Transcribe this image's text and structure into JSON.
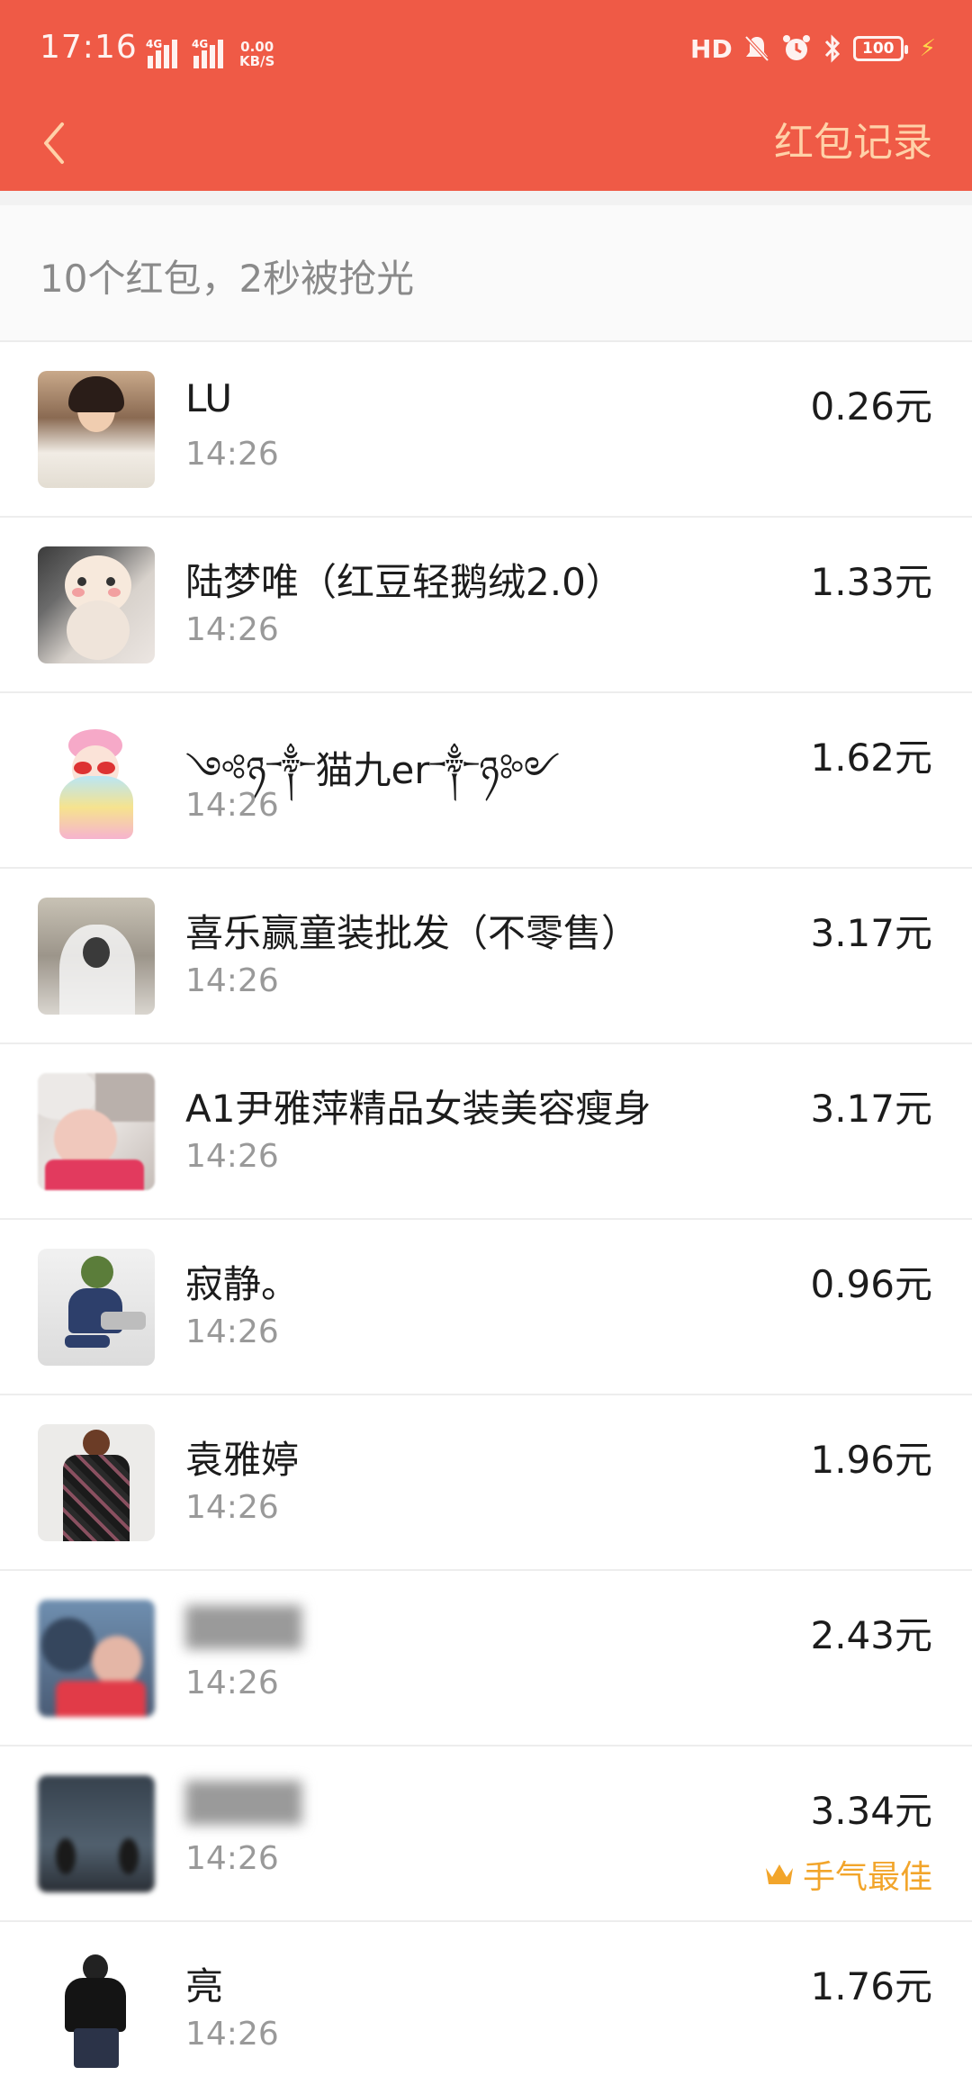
{
  "status_bar": {
    "time": "17:16",
    "signal_1_tag": "4G",
    "signal_2_tag": "4G",
    "net_speed_value": "0.00",
    "net_speed_unit": "KB/S",
    "hd_label": "HD",
    "battery_level": "100"
  },
  "nav": {
    "title": "红包记录"
  },
  "summary": {
    "text": "10个红包，2秒被抢光"
  },
  "records": [
    {
      "name": "LU",
      "time": "14:26",
      "amount": "0.26元",
      "avatar": "photo-girl-white-jacket"
    },
    {
      "name": "陆梦唯（红豆轻鹅绒2.0）",
      "time": "14:26",
      "amount": "1.33元",
      "avatar": "cat-photo"
    },
    {
      "name": "༺ཉ༒猫九er༒ཉ༻",
      "time": "14:26",
      "amount": "1.62元",
      "avatar": "cartoon-girl"
    },
    {
      "name": "喜乐赢童装批发（不零售）",
      "time": "14:26",
      "amount": "3.17元",
      "avatar": "veil-photo"
    },
    {
      "name": "A1尹雅萍精品女装美容瘦身",
      "time": "14:26",
      "amount": "3.17元",
      "avatar": "blurred-child"
    },
    {
      "name": "寂静。",
      "time": "14:26",
      "amount": "0.96元",
      "avatar": "frog-cartoon"
    },
    {
      "name": "袁雅婷",
      "time": "14:26",
      "amount": "1.96元",
      "avatar": "fashion-coat"
    },
    {
      "name": "",
      "time": "14:26",
      "amount": "2.43元",
      "avatar": "blurred-family"
    },
    {
      "name": "",
      "time": "14:26",
      "amount": "3.34元",
      "avatar": "blurred-dark",
      "badge": "手气最佳"
    },
    {
      "name": "亮",
      "time": "14:26",
      "amount": "1.76元",
      "avatar": "man-black-hoodie"
    }
  ],
  "colors": {
    "header_bg": "#ef5a46",
    "title_color": "#ffd1a8",
    "best_badge": "#f2a52b"
  }
}
